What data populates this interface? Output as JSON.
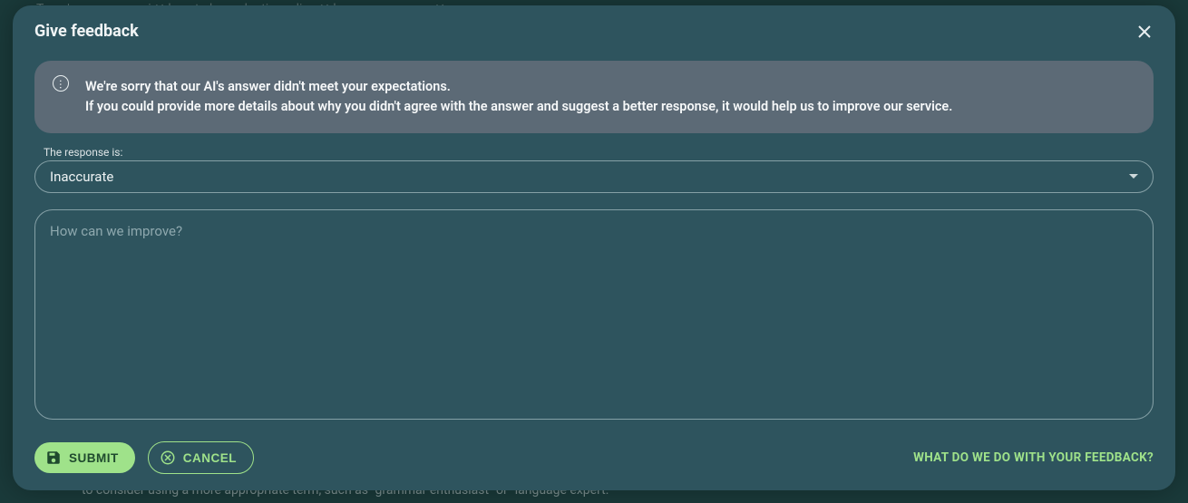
{
  "background": {
    "top_hints": "Tags   |      grammar nazi  ✕      how to be pedantic on-line  ✕      language morons  ✕",
    "bottom_text": "to consider using a more appropriate term, such as \"grammar enthusiast\" or \"language expert.\""
  },
  "modal": {
    "title": "Give feedback",
    "info_line1": "We're sorry that our AI's answer didn't meet your expectations.",
    "info_line2": "If you could provide more details about why you didn't agree with the answer and suggest a better response, it would help us to improve our service.",
    "response_label": "The response is:",
    "response_value": "Inaccurate",
    "textarea_placeholder": "How can we improve?",
    "textarea_value": "",
    "submit_label": "Submit",
    "cancel_label": "Cancel",
    "feedback_link": "What do we do with your feedback?"
  }
}
